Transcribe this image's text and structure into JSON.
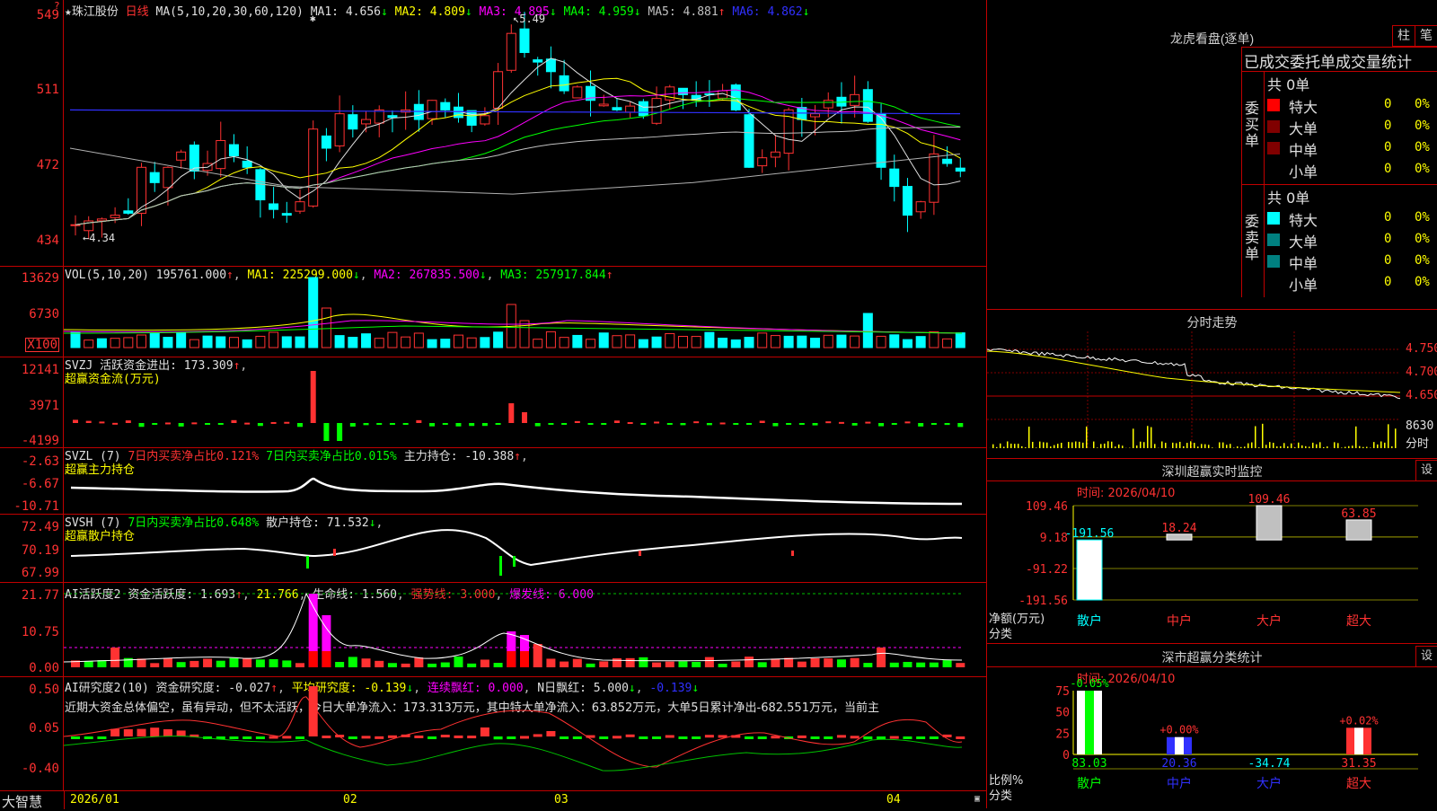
{
  "main": {
    "price_ticks": [
      "549",
      "511",
      "472",
      "434"
    ],
    "stock_name": "★珠江股份",
    "period": "日线",
    "ma_params": "MA(5,10,20,30,60,120)",
    "ma_values": [
      {
        "label": "MA1: 4.656",
        "arrow": "↓",
        "color": "#e0e0e0"
      },
      {
        "label": "MA2: 4.809",
        "arrow": "↓",
        "color": "#ffff00"
      },
      {
        "label": "MA3: 4.895",
        "arrow": "↓",
        "color": "#ff00ff"
      },
      {
        "label": "MA4: 4.959",
        "arrow": "↓",
        "color": "#00ff00"
      },
      {
        "label": "MA5: 4.881",
        "arrow": "↑",
        "color": "#c0c0c0"
      },
      {
        "label": "MA6: 4.862",
        "arrow": "↓",
        "color": "#3030ff"
      }
    ],
    "high_label": "5.49",
    "low_label": "4.34"
  },
  "vol": {
    "ticks": [
      "13629",
      "6730",
      "X100"
    ],
    "params": "VOL(5,10,20)",
    "value": "195761.000",
    "ma1": "MA1: 225299.000",
    "ma2": "MA2: 267835.500",
    "ma3": "MA3: 257917.844"
  },
  "svzj": {
    "ticks": [
      "12141",
      "3971",
      "-4199"
    ],
    "line1": "SVZJ  活跃资金进出: 173.309",
    "line2": "超赢资金流(万元)"
  },
  "svzl": {
    "ticks": [
      "-2.63",
      "-6.67",
      "-10.71"
    ],
    "p1": "SVZL (7)",
    "p2": "7日内买卖净占比0.121%",
    "p3": "7日内买卖净占比0.015%",
    "p4": "主力持仓: -10.388",
    "line2": "超赢主力持仓"
  },
  "svsh": {
    "ticks": [
      "72.49",
      "70.19",
      "67.99"
    ],
    "p1": "SVSH (7)",
    "p2": "7日内买卖净占比0.648%",
    "p3": "散户持仓: 71.532",
    "line2": "超赢散户持仓"
  },
  "ai1": {
    "ticks": [
      "21.77",
      "10.75",
      "0.00"
    ],
    "p1": "AI活跃度2",
    "p2": "资金活跃度: 1.693",
    "p3": "21.766",
    "p4": "生命线: 1.560",
    "p5": "强势线: 3.000",
    "p6": "爆发线: 6.000"
  },
  "ai2": {
    "ticks": [
      "0.50",
      "0.05",
      "-0.40"
    ],
    "p1": "AI研究度2(10)",
    "p2": "资金研究度: -0.027",
    "p3": "平均研究度: -0.139",
    "p4": "连续飘红: 0.000",
    "p5": "N日飘红: 5.000",
    "p6": "-0.139",
    "text": "近期大资金总体偏空，虽有异动，但不太活跃，今日大单净流入：173.313万元，其中特大单净流入：63.852万元，大单5日累计净出-682.551万元，当前主"
  },
  "xaxis": {
    "brand": "大智慧",
    "labels": [
      "2026/01",
      "02",
      "03",
      "04"
    ]
  },
  "dragon": {
    "title": "龙虎看盘(逐单)",
    "btn1": "柱",
    "btn2": "笔",
    "tabs": "已成交委托单成交量统计",
    "buy_label": "委买单",
    "sell_label": "委卖单",
    "buy_total": "共 0单",
    "sell_total": "共 0单",
    "buy_rows": [
      {
        "name": "特大",
        "count": "0",
        "pct": "0%",
        "color": "#ff0000"
      },
      {
        "name": "大单",
        "count": "0",
        "pct": "0%",
        "color": "#800000"
      },
      {
        "name": "中单",
        "count": "0",
        "pct": "0%",
        "color": "#800000"
      },
      {
        "name": "小单",
        "count": "0",
        "pct": "0%",
        "color": "#000000"
      }
    ],
    "sell_rows": [
      {
        "name": "特大",
        "count": "0",
        "pct": "0%",
        "color": "#00ffff"
      },
      {
        "name": "大单",
        "count": "0",
        "pct": "0%",
        "color": "#008080"
      },
      {
        "name": "中单",
        "count": "0",
        "pct": "0%",
        "color": "#008080"
      },
      {
        "name": "小单",
        "count": "0",
        "pct": "0%",
        "color": "#000000"
      }
    ]
  },
  "intraday": {
    "title": "分时走势",
    "ticks": [
      "4.750",
      "4.700",
      "4.650"
    ],
    "vol_tick": "8630",
    "vol_label": "分时"
  },
  "monitor": {
    "title": "深圳超赢实时监控",
    "btn": "设",
    "time": "时间: 2026/04/10",
    "ticks": [
      "109.46",
      "9.18",
      "-91.22",
      "-191.56"
    ],
    "ylabel": "净额(万元)",
    "xlabel": "分类",
    "categories": [
      "散户",
      "中户",
      "大户",
      "超大"
    ],
    "values": [
      "-191.56",
      "18.24",
      "109.46",
      "63.85"
    ]
  },
  "classify": {
    "title": "深市超赢分类统计",
    "btn": "设",
    "time": "时间: 2026/04/10",
    "ticks": [
      "75",
      "50",
      "25",
      "0"
    ],
    "ylabel": "比例%",
    "xlabel": "分类",
    "categories": [
      "散户",
      "中户",
      "大户",
      "超大"
    ],
    "top_labels": [
      "-0.05%",
      "+0.00%",
      "",
      "+0.02%"
    ],
    "bottom_values": [
      "83.03",
      "20.36",
      "-34.74",
      "31.35"
    ]
  },
  "chart_data": [
    {
      "type": "bar",
      "title": "深圳超赢实时监控",
      "categories": [
        "散户",
        "中户",
        "大户",
        "超大"
      ],
      "values": [
        -191.56,
        18.24,
        109.46,
        63.85
      ],
      "ylabel": "净额(万元)",
      "ylim": [
        -191.56,
        109.46
      ]
    },
    {
      "type": "bar",
      "title": "深市超赢分类统计",
      "categories": [
        "散户",
        "中户",
        "大户",
        "超大"
      ],
      "values": [
        83.03,
        20.36,
        -34.74,
        31.35
      ],
      "ylabel": "比例%"
    }
  ]
}
